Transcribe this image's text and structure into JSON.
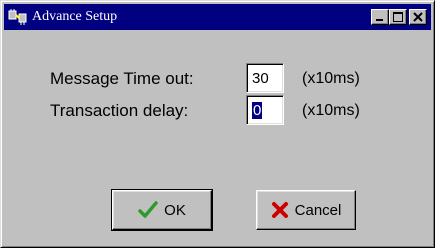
{
  "window": {
    "title": "Advance Setup",
    "app_icon": "network-plugs-icon",
    "controls": [
      "minimize-icon",
      "maximize-icon",
      "close-icon"
    ]
  },
  "form": {
    "message_timeout": {
      "label": "Message Time out:",
      "value": "30",
      "unit": "(x10ms)"
    },
    "transaction_delay": {
      "label": "Transaction delay:",
      "value": "0",
      "unit": "(x10ms)"
    }
  },
  "buttons": {
    "ok": {
      "label": "OK",
      "icon": "checkmark-icon",
      "icon_color": "#2e9a2e"
    },
    "cancel": {
      "label": "Cancel",
      "icon": "x-mark-icon",
      "icon_color": "#cc0000"
    }
  },
  "colors": {
    "titlebar": "#000080",
    "face": "#c0c0c0"
  }
}
